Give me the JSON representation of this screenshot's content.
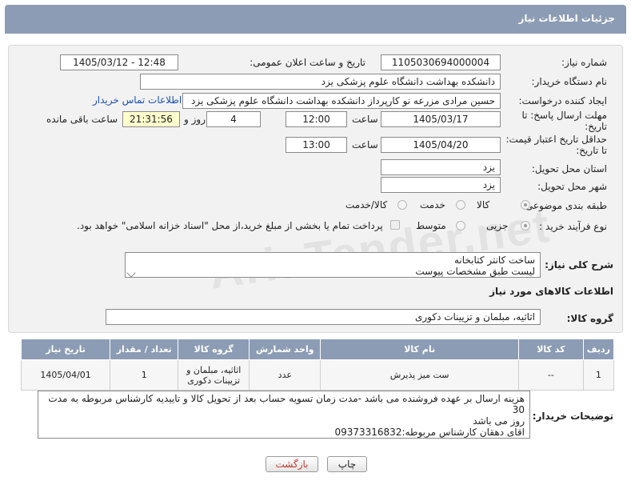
{
  "window": {
    "title": "جزئیات اطلاعات نیاز"
  },
  "form": {
    "need_number": {
      "label": "شماره نیاز:",
      "value": "1105030694000004"
    },
    "announce_datetime": {
      "label": "تاریخ و ساعت اعلان عمومی:",
      "value": "1405/03/12 - 12:48"
    },
    "buyer_org": {
      "label": "نام دستگاه خریدار:",
      "value": "دانشکده بهداشت دانشگاه علوم پزشکی یزد"
    },
    "requester": {
      "label": "ایجاد کننده درخواست:",
      "value": "حسین مرادی مزرعه نو کارپرداز دانشکده بهداشت دانشگاه علوم پزشکی یزد",
      "contact_link": "اطلاعات تماس خریدار"
    },
    "reply_deadline": {
      "label_line1": "مهلت ارسال پاسخ: تا",
      "label_line2": "تاریخ:",
      "date": "1405/03/17",
      "time_label": "ساعت",
      "time": "12:00",
      "days": "4",
      "days_label": "روز و",
      "remaining": "21:31:56",
      "remaining_label": "ساعت باقی مانده"
    },
    "price_validity": {
      "label_line1": "حداقل تاریخ اعتبار قیمت:",
      "label_line2": "تا تاریخ:",
      "date": "1405/04/20",
      "time_label": "ساعت",
      "time": "13:00"
    },
    "delivery_province": {
      "label": "استان محل تحویل:",
      "value": "یزد"
    },
    "delivery_city": {
      "label": "شهر محل تحویل:",
      "value": "یزد"
    },
    "category": {
      "label": "طبقه بندی موضوعی:",
      "options": [
        "کالا",
        "خدمت",
        "کالا/خدمت"
      ],
      "selected": "کالا"
    },
    "purchase_type": {
      "label": "نوع فرآیند خرید :",
      "options": [
        "جزیی",
        "متوسط"
      ],
      "selected": "جزیی",
      "treasury_note": "پرداخت تمام یا بخشی از مبلغ خرید،از محل \"اسناد خزانه اسلامی\" خواهد بود."
    },
    "general_desc": {
      "label": "شرح کلی نیاز:",
      "line1": "ساخت کانتر کتابخانه",
      "line2": "لیست طبق مشخصات پیوست"
    }
  },
  "goods_section": {
    "title": "اطلاعات کالاهای مورد نیاز",
    "group_label": "گروه کالا:",
    "group_value": "اثاثیه، مبلمان و تزیینات دکوری",
    "table": {
      "headers": [
        "ردیف",
        "کد کالا",
        "نام کالا",
        "واحد شمارش",
        "گروه کالا",
        "تعداد / مقدار",
        "تاریخ نیاز"
      ],
      "rows": [
        [
          "1",
          "--",
          "ست میز پذیرش",
          "عدد",
          "اثاثیه، مبلمان و تزیینات دکوری",
          "1",
          "1405/04/01"
        ]
      ]
    }
  },
  "buyer_notes": {
    "label": "توضیحات خریدار:",
    "line1": "هزینه ارسال بر عهده فروشنده می باشد  -مدت زمان تسویه حساب بعد از تحویل کالا و تاییدیه کارشناس مربوطه به مدت 30",
    "line2": "روز می باشد",
    "line3": "اقای دهقان کارشناس مربوطه:09373316832"
  },
  "buttons": {
    "print": "چاپ",
    "back": "بازگشت"
  },
  "colors": {
    "header_bg": "#8c9cb4",
    "link": "#1a4fb5",
    "back_text": "#c0392b",
    "yellow_field": "#ffffcc"
  }
}
